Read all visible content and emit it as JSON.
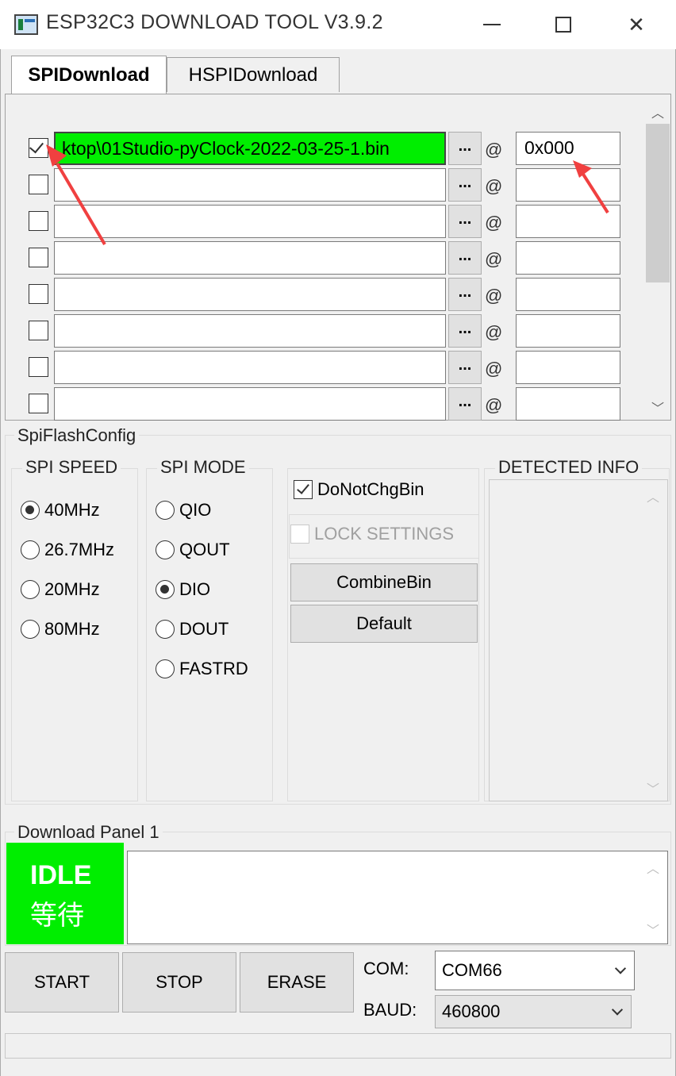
{
  "window": {
    "title": "ESP32C3 DOWNLOAD TOOL V3.9.2",
    "controls": {
      "minimize": "—",
      "maximize": "□",
      "close": "✕"
    }
  },
  "tabs": [
    {
      "label": "SPIDownload",
      "selected": true
    },
    {
      "label": "HSPIDownload",
      "selected": false
    }
  ],
  "files": {
    "browse_label": "...",
    "at_label": "@",
    "rows": [
      {
        "checked": true,
        "path": "ktop\\01Studio-pyClock-2022-03-25-1.bin",
        "offset": "0x000"
      },
      {
        "checked": false,
        "path": "",
        "offset": ""
      },
      {
        "checked": false,
        "path": "",
        "offset": ""
      },
      {
        "checked": false,
        "path": "",
        "offset": ""
      },
      {
        "checked": false,
        "path": "",
        "offset": ""
      },
      {
        "checked": false,
        "path": "",
        "offset": ""
      },
      {
        "checked": false,
        "path": "",
        "offset": ""
      },
      {
        "checked": false,
        "path": "",
        "offset": ""
      }
    ]
  },
  "config": {
    "group_title": "SpiFlashConfig",
    "spi_speed": {
      "title": "SPI SPEED",
      "options": [
        "40MHz",
        "26.7MHz",
        "20MHz",
        "80MHz"
      ],
      "selected": "40MHz"
    },
    "spi_mode": {
      "title": "SPI MODE",
      "options": [
        "QIO",
        "QOUT",
        "DIO",
        "DOUT",
        "FASTRD"
      ],
      "selected": "DIO"
    },
    "do_not_chg_bin": {
      "label": "DoNotChgBin",
      "checked": true
    },
    "lock_settings": {
      "label": "LOCK SETTINGS",
      "checked": false,
      "disabled": true
    },
    "combine_bin_label": "CombineBin",
    "default_label": "Default",
    "detected_info_title": "DETECTED INFO"
  },
  "download": {
    "panel_title": "Download Panel 1",
    "status_en": "IDLE",
    "status_cn": "等待",
    "status_color": "#00ee00",
    "start_label": "START",
    "stop_label": "STOP",
    "erase_label": "ERASE",
    "com_label": "COM:",
    "com_value": "COM66",
    "baud_label": "BAUD:",
    "baud_value": "460800"
  },
  "annotation_color": "#f04040"
}
